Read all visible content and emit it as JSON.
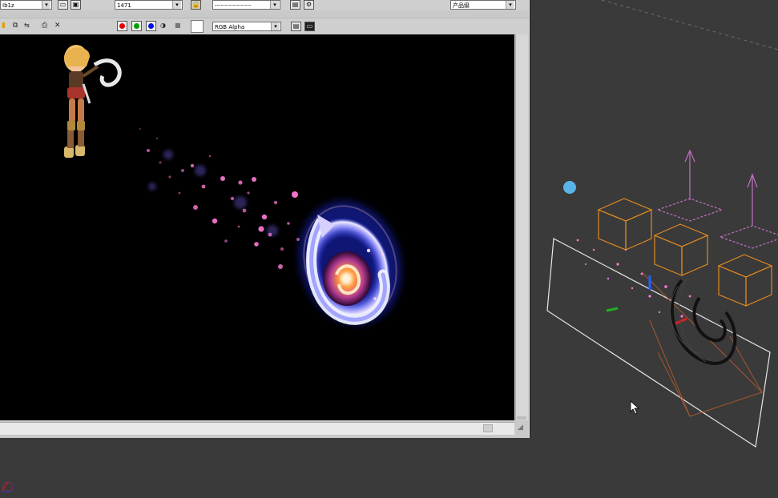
{
  "render_window": {
    "toolbar1": {
      "area_select": "Ib1z",
      "viewport_select": "1471",
      "preset_select": "------------------",
      "renderer_select": "产品级"
    },
    "toolbar2": {
      "channel_select": "RGB Alpha",
      "channels": [
        {
          "name": "red",
          "color": "#e00000"
        },
        {
          "name": "green",
          "color": "#00a000"
        },
        {
          "name": "blue",
          "color": "#0010e0"
        }
      ],
      "clear_symbol": "✕"
    }
  },
  "viewport_colors": {
    "background": "#000000",
    "particles": "#ff7ad9",
    "portal_core": "#ff9a40",
    "portal_glow": "#8a8cff"
  },
  "scene_colors": {
    "background": "#3a3a3a",
    "helper_boxes": "#e08a20",
    "emitter_plane": "#ffffff",
    "gravity_arrows": "#c070c0"
  }
}
